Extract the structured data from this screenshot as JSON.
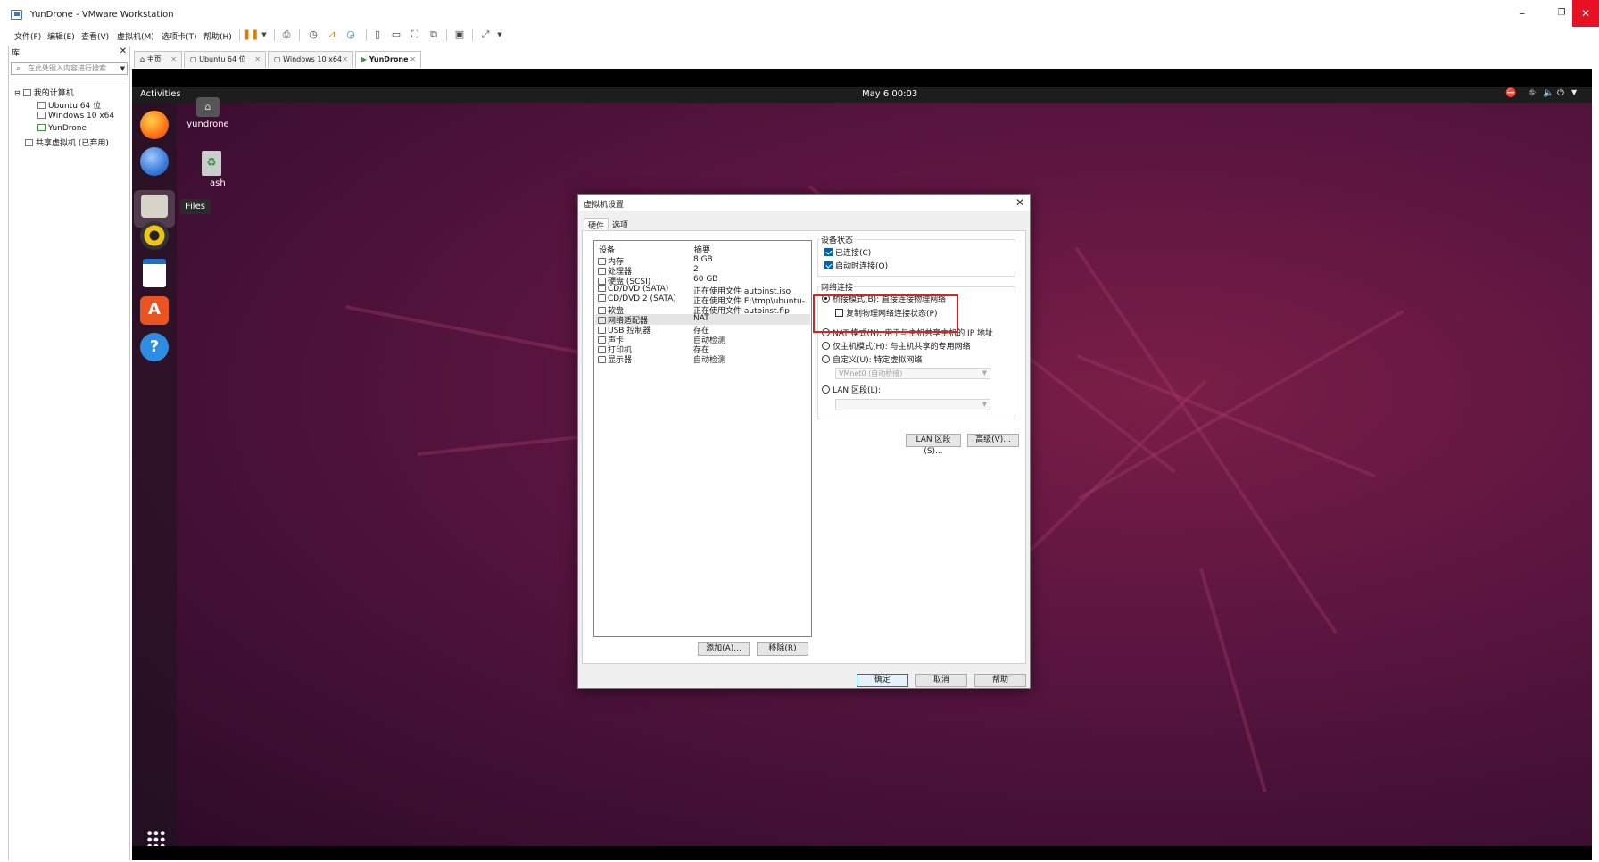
{
  "window": {
    "title": "YunDrone - VMware Workstation",
    "minimize": "–",
    "restore": "❐",
    "close": "✕"
  },
  "menu": [
    "文件(F)",
    "编辑(E)",
    "查看(V)",
    "虚拟机(M)",
    "选项卡(T)",
    "帮助(H)"
  ],
  "library": {
    "title": "库",
    "close": "✕",
    "search_placeholder": "在此处键入内容进行搜索",
    "tree": {
      "root": "我的计算机",
      "vms": [
        "Ubuntu 64 位",
        "Windows 10 x64",
        "YunDrone"
      ],
      "shared": "共享虚拟机 (已弃用)"
    }
  },
  "tabs": [
    {
      "label": "主页"
    },
    {
      "label": "Ubuntu 64 位"
    },
    {
      "label": "Windows 10 x64"
    },
    {
      "label": "YunDrone",
      "active": true
    }
  ],
  "ubuntu": {
    "activities": "Activities",
    "clock": "May 6  00:03",
    "tooltip": "Files",
    "desktop_home": "yundrone",
    "desktop_trash": "ash"
  },
  "dialog": {
    "title": "虚拟机设置",
    "close": "✕",
    "tabs": [
      "硬件",
      "选项"
    ],
    "col_device": "设备",
    "col_summary": "摘要",
    "devices": [
      {
        "name": "内存",
        "summary": "8 GB"
      },
      {
        "name": "处理器",
        "summary": "2"
      },
      {
        "name": "硬盘 (SCSI)",
        "summary": "60 GB"
      },
      {
        "name": "CD/DVD (SATA)",
        "summary": "正在使用文件 autoinst.iso"
      },
      {
        "name": "CD/DVD 2 (SATA)",
        "summary": "正在使用文件 E:\\tmp\\ubuntu-..."
      },
      {
        "name": "软盘",
        "summary": "正在使用文件 autoinst.flp"
      },
      {
        "name": "网络适配器",
        "summary": "NAT",
        "selected": true
      },
      {
        "name": "USB 控制器",
        "summary": "存在"
      },
      {
        "name": "声卡",
        "summary": "自动检测"
      },
      {
        "name": "打印机",
        "summary": "存在"
      },
      {
        "name": "显示器",
        "summary": "自动检测"
      }
    ],
    "add_button": "添加(A)...",
    "remove_button": "移除(R)",
    "device_status": {
      "label": "设备状态",
      "connected": "已连接(C)",
      "connect_on_power": "启动时连接(O)"
    },
    "network": {
      "label": "网络连接",
      "bridged": "桥接模式(B): 直接连接物理网络",
      "replicate": "复制物理网络连接状态(P)",
      "nat": "NAT 模式(N): 用于与主机共享主机的 IP 地址",
      "hostonly": "仅主机模式(H): 与主机共享的专用网络",
      "custom": "自定义(U): 特定虚拟网络",
      "custom_value": "VMnet0 (自动桥接)",
      "lan": "LAN 区段(L):",
      "lan_value": ""
    },
    "lan_segments_button": "LAN 区段(S)...",
    "advanced_button": "高级(V)...",
    "ok": "确定",
    "cancel": "取消",
    "help": "帮助"
  },
  "colors": {
    "highlight": "#e02020",
    "accent": "#0063b1",
    "wallpaper": "#5a1540"
  }
}
